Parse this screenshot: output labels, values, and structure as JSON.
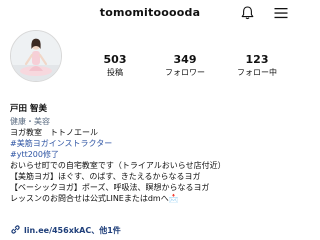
{
  "header": {
    "username": "tomomitooooda",
    "icons": [
      "bell-icon",
      "menu-icon"
    ]
  },
  "stats": {
    "posts": {
      "count": "503",
      "label": "投稿"
    },
    "followers": {
      "count": "349",
      "label": "フォロワー"
    },
    "following": {
      "count": "123",
      "label": "フォロー中"
    }
  },
  "bio": {
    "name": "戸田 智美",
    "category": "健康・美容",
    "lines": [
      "ヨガ教室　トトノエール",
      "#美筋ヨガインストラクター",
      "#ytt200修了",
      "おいらせ町での自宅教室です（トライアルおいらせ店付近）",
      "【美筋ヨガ】ほぐす、のばす、きたえるからなるヨガ",
      "【ベーシックヨガ】ポーズ、呼吸法、瞑想からなるヨガ",
      "レッスンのお問合せは公式LINEまたはdmへ📩"
    ]
  },
  "link": {
    "text": "lin.ee/456xkAC、他1件",
    "icon": "link-icon"
  },
  "colors": {
    "hashtag": "#2f55a4",
    "category": "#5b6c82",
    "link": "#1f3f7a"
  }
}
